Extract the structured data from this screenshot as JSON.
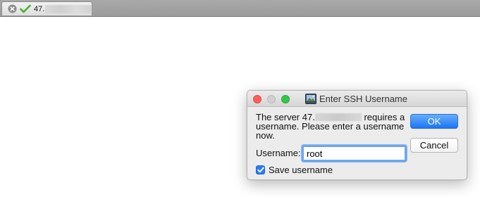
{
  "tab": {
    "title": "47.",
    "icons": [
      "close-icon",
      "connected-check-icon"
    ]
  },
  "dialog": {
    "title": "Enter SSH Username",
    "message_part1": "The server 47.",
    "message_part2": " requires a username.  Please enter a username now.",
    "ok_label": "OK",
    "cancel_label": "Cancel",
    "username_label": "Username:",
    "username_value": "root",
    "save_label": "Save username",
    "save_checked": true
  },
  "colors": {
    "accent": "#1a74f5",
    "focus_ring": "#6fa5ee",
    "close_light": "#fc5f57",
    "zoom_light": "#33c748"
  }
}
